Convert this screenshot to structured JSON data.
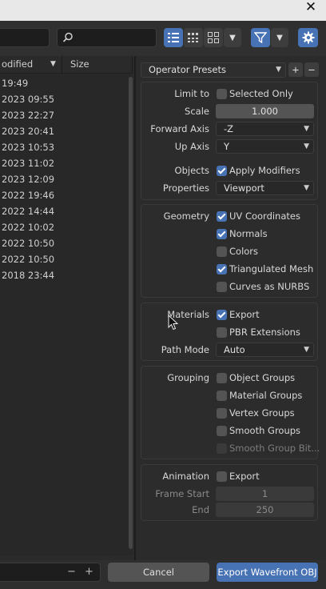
{
  "window": {
    "close_glyph": "✕"
  },
  "toolbar": {
    "search_icon": "search-icon",
    "filter_icon": "filter-icon",
    "gear_icon": "gear-icon"
  },
  "file_list": {
    "columns": [
      "odified",
      "Size"
    ],
    "rows": [
      "19:49",
      "2023 09:55",
      "2023 22:27",
      "2023 20:41",
      "2023 10:53",
      "2023 11:02",
      "2023 12:09",
      "2022 19:46",
      "2022 14:44",
      "2022 10:02",
      "2022 10:50",
      "2022 10:50",
      "2018 23:44"
    ]
  },
  "presets": {
    "label": "Operator Presets",
    "add": "+",
    "remove": "−"
  },
  "transform": {
    "limit_to_label": "Limit to",
    "selected_only": "Selected Only",
    "selected_only_checked": false,
    "scale_label": "Scale",
    "scale_value": "1.000",
    "forward_axis_label": "Forward Axis",
    "forward_axis_value": "-Z",
    "up_axis_label": "Up Axis",
    "up_axis_value": "Y",
    "objects_label": "Objects",
    "apply_modifiers": "Apply Modifiers",
    "apply_modifiers_checked": true,
    "properties_label": "Properties",
    "properties_value": "Viewport"
  },
  "geometry": {
    "label": "Geometry",
    "uv": "UV Coordinates",
    "normals": "Normals",
    "colors": "Colors",
    "triangulated": "Triangulated Mesh",
    "nurbs": "Curves as NURBS"
  },
  "materials": {
    "label": "Materials",
    "export": "Export",
    "pbr": "PBR Extensions",
    "path_mode_label": "Path Mode",
    "path_mode_value": "Auto"
  },
  "grouping": {
    "label": "Grouping",
    "object_groups": "Object Groups",
    "material_groups": "Material Groups",
    "vertex_groups": "Vertex Groups",
    "smooth_groups": "Smooth Groups",
    "smooth_bits": "Smooth Group Bit..."
  },
  "animation": {
    "label": "Animation",
    "export": "Export",
    "frame_start_label": "Frame Start",
    "frame_start_value": "1",
    "end_label": "End",
    "end_value": "250"
  },
  "bottom": {
    "minus": "−",
    "plus": "+",
    "cancel": "Cancel",
    "export_button": "Export Wavefront OBJ"
  },
  "colors": {
    "accent": "#4772b3",
    "panel": "#2b2b2b"
  }
}
